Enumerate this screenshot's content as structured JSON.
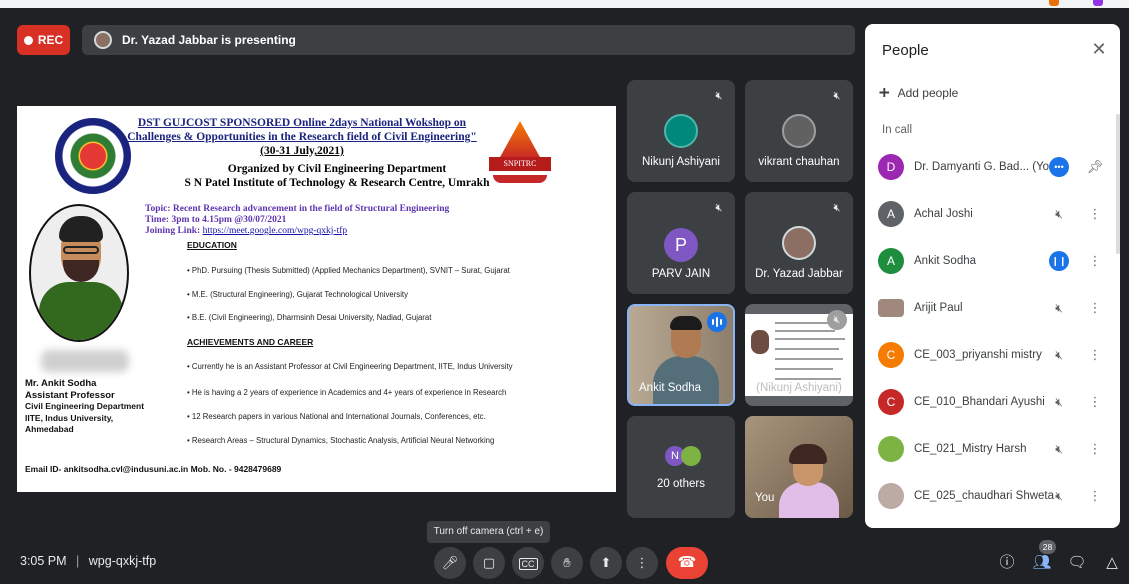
{
  "rec_label": "REC",
  "presenting": "Dr. Yazad Jabbar is presenting",
  "slide": {
    "heading_line1": "DST GUJCOST SPONSORED Online 2days National Wokshop on",
    "heading_line2": "Challenges & Opportunities in the Research field of Civil Engineering\"",
    "heading_line3": "(30-31 July,2021)",
    "org_line1": "Organized by Civil Engineering Department",
    "org_line2": "S N Patel Institute of Technology & Research Centre, Umrakh",
    "logo_text": "SNPITRC",
    "topic": "Topic: Recent Research advancement in the field of Structural Engineering",
    "time": "Time: 3pm to 4.15pm @30/07/2021",
    "joining_label": "Joining Link: ",
    "joining_link": "https://meet.google.com/wpg-qxkj-tfp",
    "education_title": "EDUCATION",
    "education": [
      "• PhD. Pursuing (Thesis Submitted) (Applied Mechanics Department), SVNIT – Surat, Gujarat",
      "• M.E. (Structural Engineering), Gujarat Technological University",
      "• B.E. (Civil Engineering), Dharmsinh Desai University, Nadiad, Gujarat"
    ],
    "achievements_title": "ACHIEVEMENTS AND CAREER",
    "achievements": [
      "• Currently he is an Assistant Professor at Civil Engineering Department, IITE, Indus University",
      "• He is having a 2 years of experience in Academics and 4+ years of experience in Research",
      "• 12 Research papers in various National and International Journals, Conferences, etc.",
      "• Research Areas – Structural Dynamics, Stochastic Analysis, Artificial Neural Networking"
    ],
    "speaker_name": "Mr. Ankit Sodha",
    "speaker_title": "Assistant Professor",
    "speaker_dept": "Civil Engineering Department",
    "speaker_inst": "IITE, Indus University,",
    "speaker_city": "Ahmedabad",
    "email": "Email ID- ankitsodha.cvl@indusuni.ac.in Mob. No. - 9428479689"
  },
  "tiles": {
    "nikunj": "Nikunj Ashiyani",
    "vikrant": "vikrant chauhan",
    "parv": "PARV JAIN",
    "parv_initial": "P",
    "yazad": "Dr. Yazad Jabbar",
    "ankit": "Ankit Sodha",
    "nikunj_pres": "(Nikunj Ashiyani)",
    "others": "20 others",
    "others_initial": "N",
    "you": "You"
  },
  "people": {
    "title": "People",
    "add_people": "Add people",
    "in_call": "In call",
    "list": [
      {
        "name": "Dr. Damyanti G. Bad... (You)",
        "initial": "D",
        "color": "#9c27b0"
      },
      {
        "name": "Achal Joshi",
        "initial": "A",
        "color": "#5f6368"
      },
      {
        "name": "Ankit Sodha",
        "initial": "A",
        "color": "#1e8e3e"
      },
      {
        "name": "Arijit Paul",
        "initial": "",
        "color": "#a1887f"
      },
      {
        "name": "CE_003_priyanshi mistry",
        "initial": "C",
        "color": "#f57c00"
      },
      {
        "name": "CE_010_Bhandari Ayushi",
        "initial": "C",
        "color": "#c62828"
      },
      {
        "name": "CE_021_Mistry Harsh",
        "initial": "",
        "color": "#7cb342"
      },
      {
        "name": "CE_025_chaudhari Shweta",
        "initial": "",
        "color": "#bcaaa4"
      }
    ]
  },
  "tooltip": "Turn off camera (ctrl + e)",
  "bottom": {
    "time": "3:05 PM",
    "separator": "|",
    "meeting_code": "wpg-qxkj-tfp",
    "participants_count": "28"
  }
}
